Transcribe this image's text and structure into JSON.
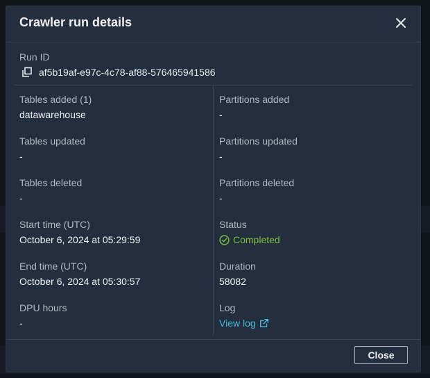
{
  "dialog": {
    "title": "Crawler run details",
    "run_id_label": "Run ID",
    "run_id": "af5b19af-e97c-4c78-af88-576465941586",
    "fields": {
      "tables_added": {
        "label": "Tables added (1)",
        "value": "datawarehouse"
      },
      "tables_updated": {
        "label": "Tables updated",
        "value": "-"
      },
      "tables_deleted": {
        "label": "Tables deleted",
        "value": "-"
      },
      "start_time": {
        "label": "Start time (UTC)",
        "value": "October 6, 2024 at 05:29:59"
      },
      "end_time": {
        "label": "End time (UTC)",
        "value": "October 6, 2024 at 05:30:57"
      },
      "dpu_hours": {
        "label": "DPU hours",
        "value": "-"
      },
      "partitions_added": {
        "label": "Partitions added",
        "value": "-"
      },
      "partitions_updated": {
        "label": "Partitions updated",
        "value": "-"
      },
      "partitions_deleted": {
        "label": "Partitions deleted",
        "value": "-"
      },
      "status": {
        "label": "Status",
        "value": "Completed"
      },
      "duration": {
        "label": "Duration",
        "value": "58082"
      },
      "log": {
        "label": "Log",
        "value": "View log"
      }
    },
    "close_button_label": "Close"
  },
  "icons": {
    "close": "close-icon",
    "copy": "copy-icon",
    "status": "check-circle-icon",
    "external_link": "external-link-icon"
  },
  "colors": {
    "modal_background": "#232f3e",
    "status_success": "#7dbf3e",
    "link": "#44b9d6"
  }
}
